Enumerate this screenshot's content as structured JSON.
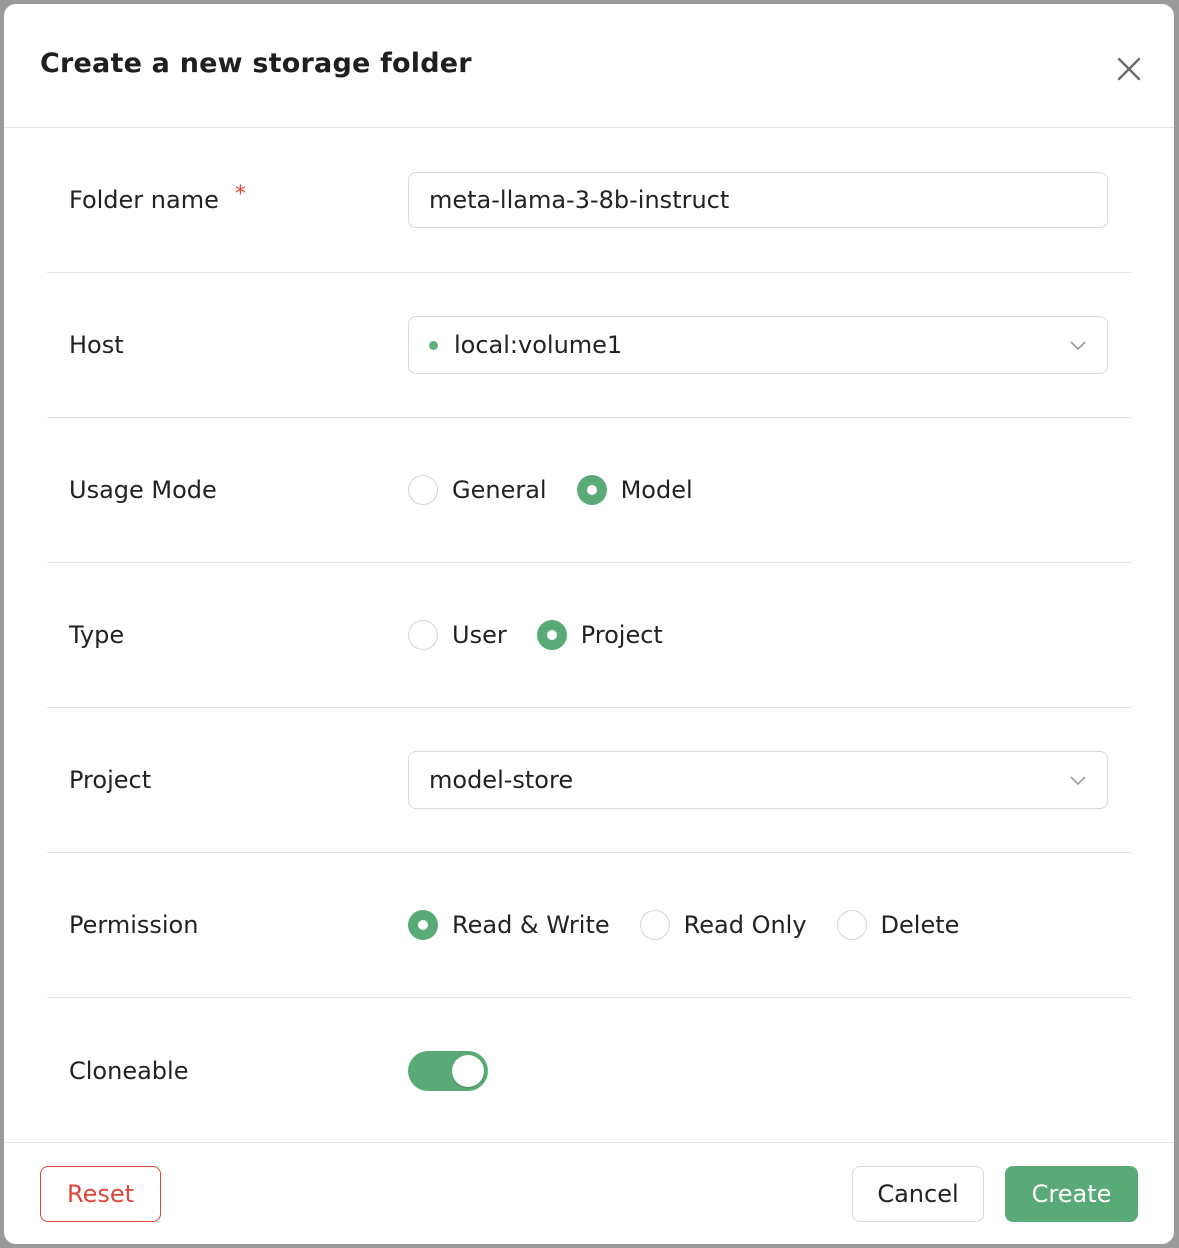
{
  "dialog": {
    "title": "Create a new storage folder"
  },
  "form": {
    "folder_name": {
      "label": "Folder name",
      "required_mark": "*",
      "value": "meta-llama-3-8b-instruct"
    },
    "host": {
      "label": "Host",
      "value": "local:volume1",
      "status_color": "#5fb07c"
    },
    "usage_mode": {
      "label": "Usage Mode",
      "options": [
        "General",
        "Model"
      ],
      "selected": "Model"
    },
    "type": {
      "label": "Type",
      "options": [
        "User",
        "Project"
      ],
      "selected": "Project"
    },
    "project": {
      "label": "Project",
      "value": "model-store"
    },
    "permission": {
      "label": "Permission",
      "options": [
        "Read & Write",
        "Read Only",
        "Delete"
      ],
      "selected": "Read & Write"
    },
    "cloneable": {
      "label": "Cloneable",
      "enabled": true
    }
  },
  "footer": {
    "reset_label": "Reset",
    "cancel_label": "Cancel",
    "create_label": "Create"
  },
  "colors": {
    "accent": "#5aaa77",
    "danger": "#e0463c"
  },
  "icons": {
    "close": "close-icon",
    "chevron": "chevron-down-icon"
  }
}
